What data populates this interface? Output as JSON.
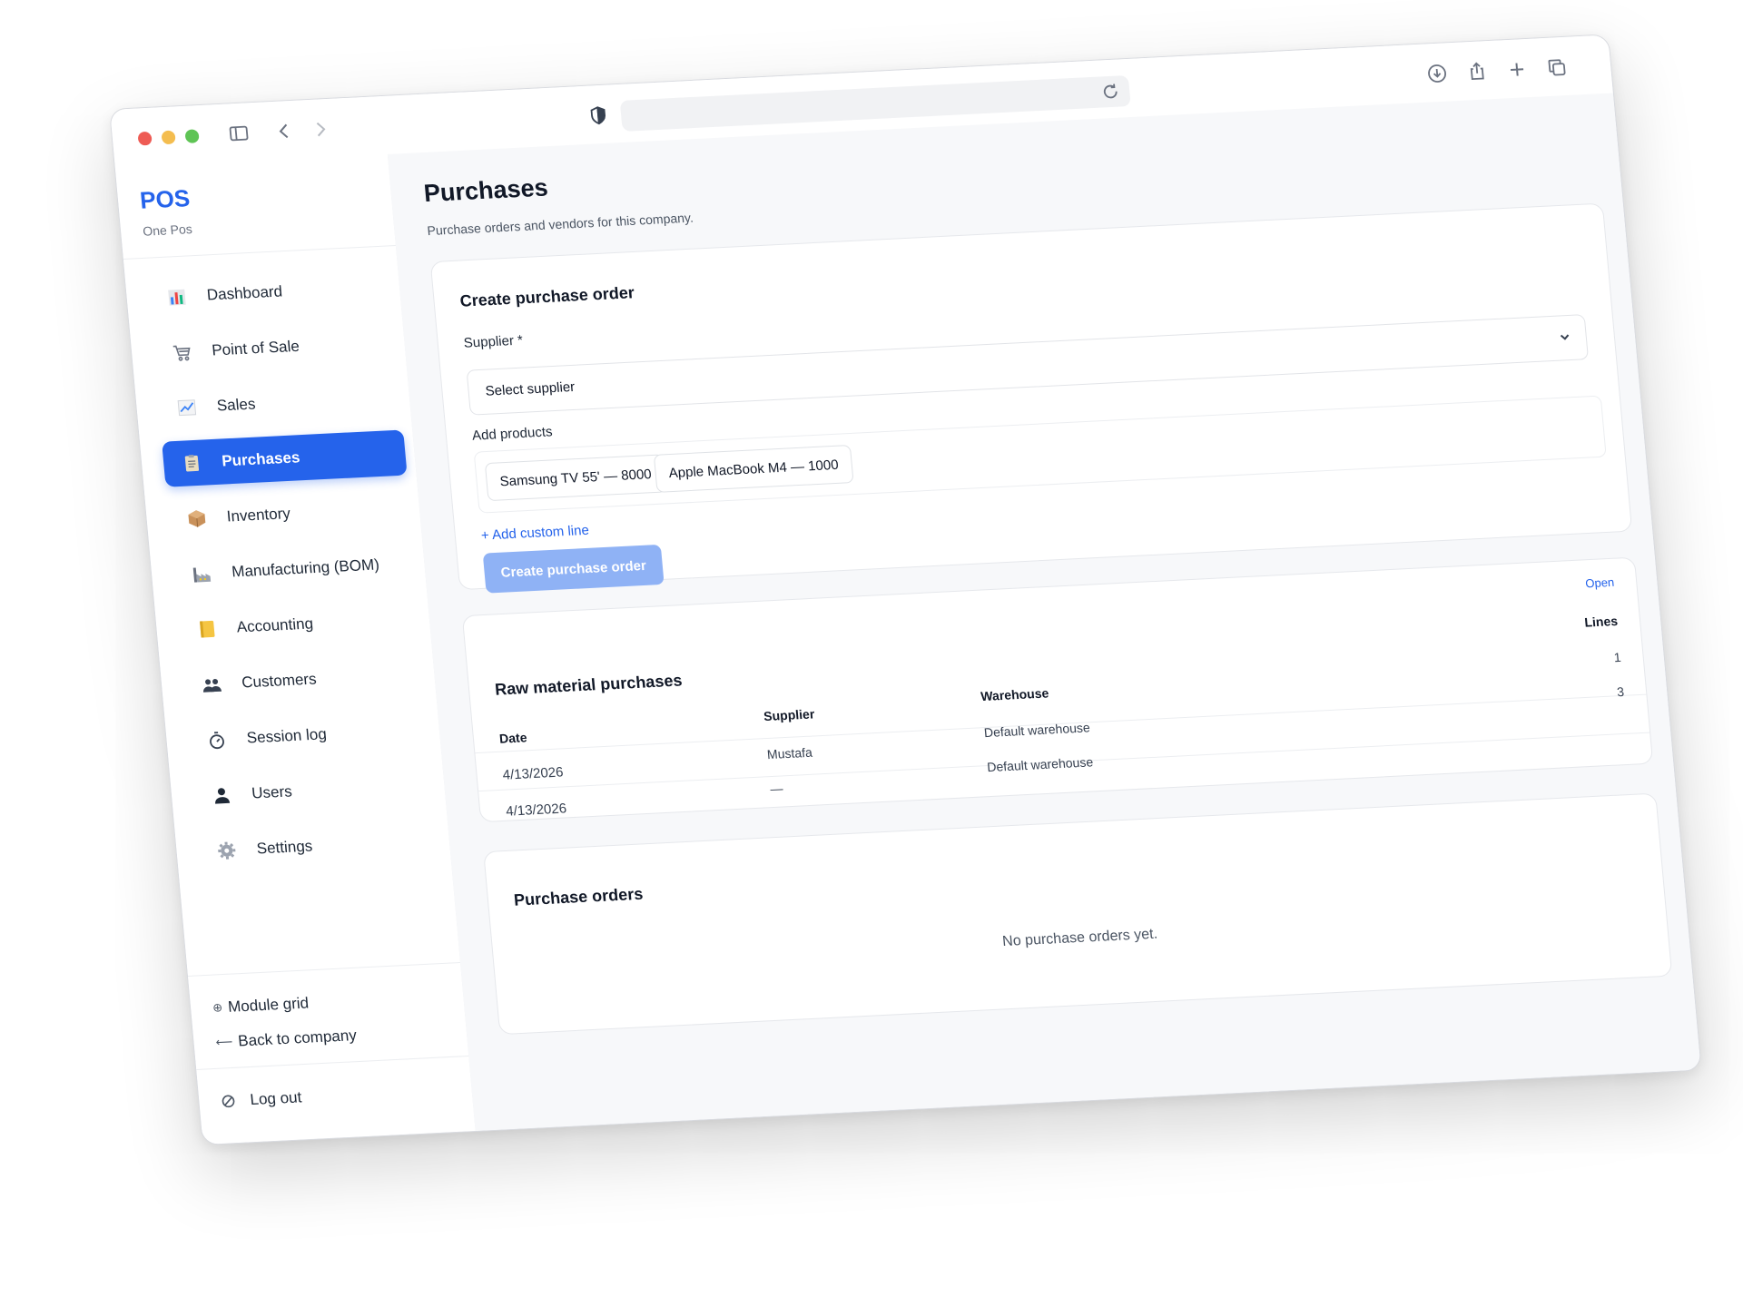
{
  "colors": {
    "accent": "#2563eb",
    "button_disabled": "#8fb2f5",
    "traffic_red": "#ee5b54",
    "traffic_yellow": "#f4bd4f",
    "traffic_green": "#5fc455"
  },
  "sidebar": {
    "brand_title": "POS",
    "brand_subtitle": "One Pos",
    "items": [
      {
        "label": "Dashboard",
        "icon": "bar-chart-icon"
      },
      {
        "label": "Point of Sale",
        "icon": "cart-icon"
      },
      {
        "label": "Sales",
        "icon": "trend-chart-icon"
      },
      {
        "label": "Purchases",
        "icon": "clipboard-icon",
        "active": true
      },
      {
        "label": "Inventory",
        "icon": "box-icon"
      },
      {
        "label": "Manufacturing (BOM)",
        "icon": "factory-icon"
      },
      {
        "label": "Accounting",
        "icon": "ledger-icon"
      },
      {
        "label": "Customers",
        "icon": "people-icon"
      },
      {
        "label": "Session log",
        "icon": "stopwatch-icon"
      },
      {
        "label": "Users",
        "icon": "user-icon"
      },
      {
        "label": "Settings",
        "icon": "gear-icon"
      }
    ],
    "module_grid": "Module grid",
    "module_grid_prefix": "⊕",
    "back_to_company": "Back to company",
    "back_arrow": "⟵",
    "logout": "Log out"
  },
  "page": {
    "title": "Purchases",
    "subtitle": "Purchase orders and vendors for this company."
  },
  "create_form": {
    "title": "Create purchase order",
    "supplier_label": "Supplier *",
    "supplier_value": "Select supplier",
    "add_products_label": "Add products",
    "products": [
      "Samsung TV 55' — 8000",
      "Apple MacBook M4 — 1000"
    ],
    "add_custom_line": "+ Add custom line",
    "submit_label": "Create purchase order"
  },
  "raw_purchases": {
    "title": "Raw material purchases",
    "open_label": "Open",
    "columns": {
      "date": "Date",
      "supplier": "Supplier",
      "warehouse": "Warehouse",
      "lines": "Lines"
    },
    "rows": [
      {
        "date": "4/13/2026",
        "supplier": "Mustafa",
        "warehouse": "Default warehouse",
        "lines": "1"
      },
      {
        "date": "4/13/2026",
        "supplier": "—",
        "warehouse": "Default warehouse",
        "lines": "3"
      }
    ]
  },
  "purchase_orders": {
    "title": "Purchase orders",
    "empty_text": "No purchase orders yet."
  }
}
